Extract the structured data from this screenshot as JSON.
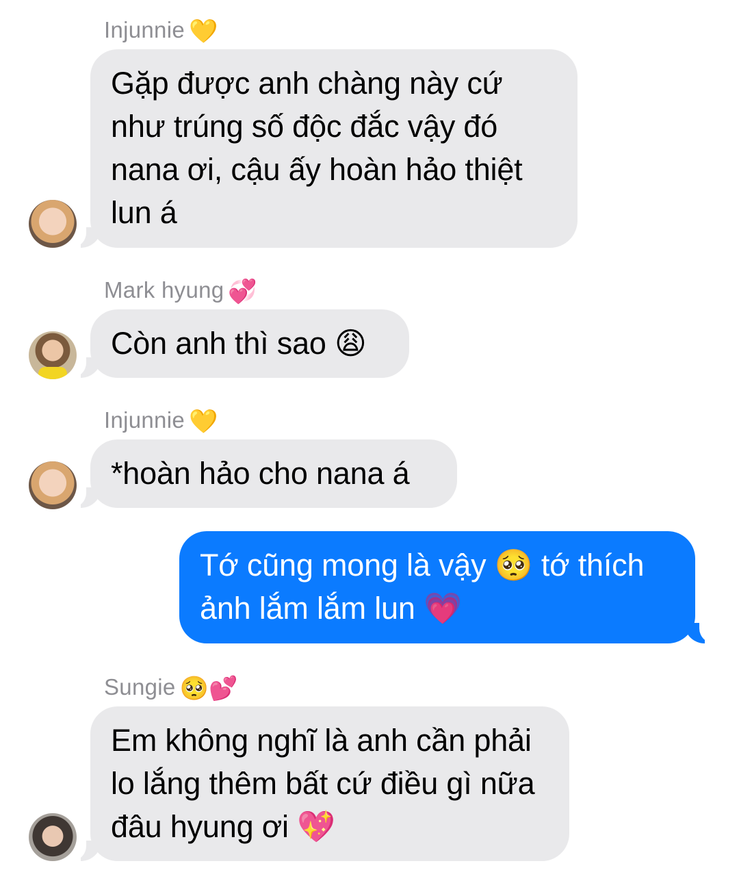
{
  "messages": [
    {
      "sender": "Injunnie",
      "sender_emoji": "💛",
      "text": "Gặp được anh chàng này cứ như trúng số độc đắc vậy đó nana ơi, cậu ấy hoàn hảo thiệt lun á",
      "direction": "incoming"
    },
    {
      "sender": "Mark hyung",
      "sender_emoji": "💞",
      "text": "Còn anh thì sao 😩",
      "direction": "incoming"
    },
    {
      "sender": "Injunnie",
      "sender_emoji": "💛",
      "text": "*hoàn hảo cho nana á",
      "direction": "incoming"
    },
    {
      "text": "Tớ cũng mong là vậy 🥺 tớ thích ảnh lắm lắm lun 💗",
      "direction": "outgoing"
    },
    {
      "sender": "Sungie",
      "sender_emoji": "🥺💕",
      "text": "Em không nghĩ là anh cần phải lo lắng thêm bất cứ điều gì nữa đâu hyung ơi 💖",
      "direction": "incoming"
    }
  ],
  "colors": {
    "incoming_bubble": "#e9e9eb",
    "outgoing_bubble": "#0b7bff",
    "sender_name": "#8e8e93"
  },
  "avatars": [
    "injunnie-avatar",
    "mark-avatar",
    "injunnie-avatar",
    "sungie-avatar"
  ]
}
